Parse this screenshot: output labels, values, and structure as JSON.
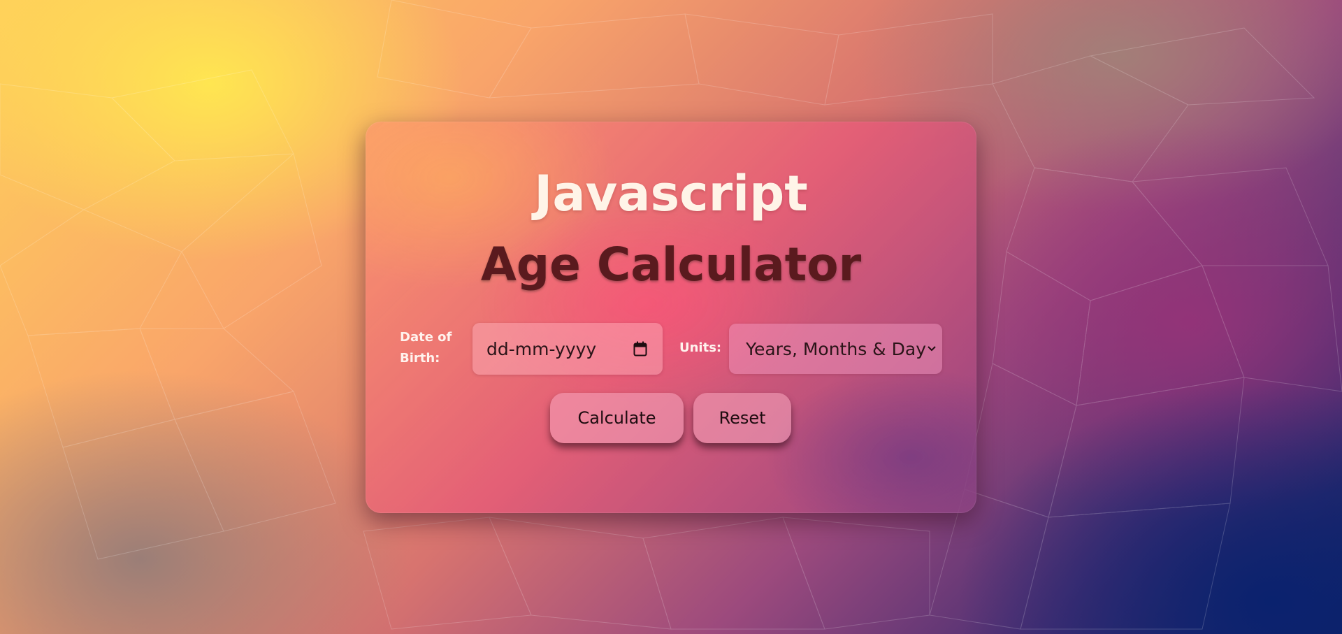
{
  "page": {
    "title_line1": "Javascript",
    "title_line2": "Age Calculator"
  },
  "form": {
    "dob_label": "Date of Birth:",
    "dob_placeholder": "dd-mm-yyyy",
    "units_label": "Units:",
    "units_selected": "Years, Months & Days",
    "calculate_label": "Calculate",
    "reset_label": "Reset"
  },
  "icons": {
    "date": "calendar-icon",
    "select": "chevron-down-icon"
  },
  "colors": {
    "title_line1": "#fff4e8",
    "title_line2": "#5a1a1e",
    "label_text": "#fff3ee"
  }
}
